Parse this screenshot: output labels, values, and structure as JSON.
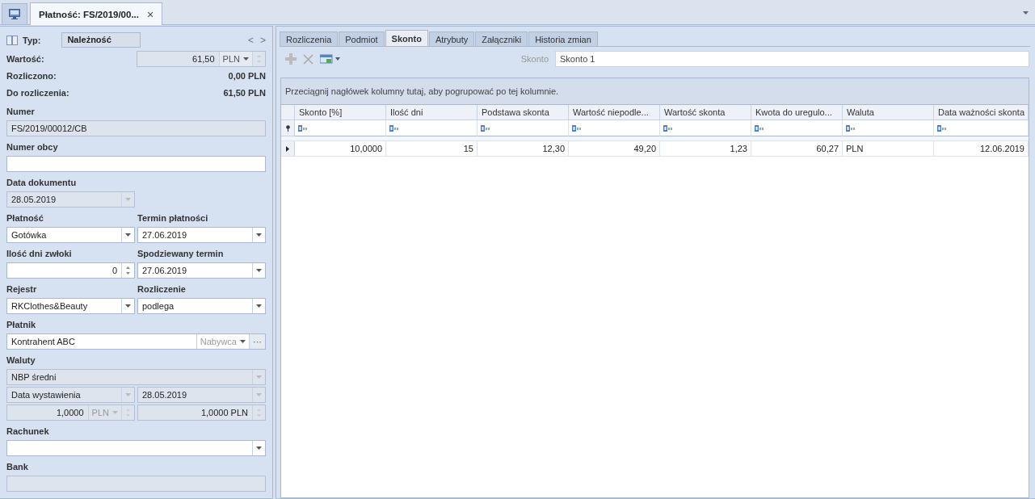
{
  "doc_tabs": [
    {
      "label": "Płatność: FS/2019/00...",
      "close": "×",
      "selected": true
    }
  ],
  "header": {
    "type_label": "Typ:",
    "type_value": "Należność",
    "prev": "<",
    "next": ">",
    "value_label": "Wartość:",
    "value_amount": "61,50",
    "value_currency": "PLN",
    "summary": [
      {
        "label": "Rozliczono:",
        "value": "0,00 PLN"
      },
      {
        "label": "Do rozliczenia:",
        "value": "61,50 PLN"
      }
    ]
  },
  "form": [
    {
      "kind": "full",
      "columns": [
        {
          "label": "Numer",
          "field": {
            "kind": "text",
            "value": "FS/2019/00012/CB",
            "disabled": true
          }
        }
      ]
    },
    {
      "kind": "full",
      "columns": [
        {
          "label": "Numer obcy",
          "field": {
            "kind": "text",
            "disabled": false
          }
        }
      ]
    },
    {
      "kind": "half",
      "columns": [
        {
          "label": "Data dokumentu",
          "field": {
            "kind": "dropdown",
            "value": "28.05.2019",
            "disabled": true
          }
        }
      ]
    },
    {
      "kind": "pair",
      "columns": [
        {
          "label": "Płatność",
          "field": {
            "kind": "dropdown",
            "value": "Gotówka",
            "disabled": false
          }
        },
        {
          "label": "Termin płatności",
          "field": {
            "kind": "dropdown",
            "value": "27.06.2019",
            "disabled": false
          }
        }
      ]
    },
    {
      "kind": "pair",
      "columns": [
        {
          "label": "Ilość dni zwłoki",
          "field": {
            "kind": "spin",
            "value": "0",
            "disabled": false
          }
        },
        {
          "label": "Spodziewany termin",
          "field": {
            "kind": "dropdown",
            "value": "27.06.2019",
            "disabled": false
          }
        }
      ]
    },
    {
      "kind": "pair",
      "columns": [
        {
          "label": "Rejestr",
          "field": {
            "kind": "dropdown",
            "value": "RKClothes&Beauty",
            "disabled": false
          }
        },
        {
          "label": "Rozliczenie",
          "field": {
            "kind": "dropdown",
            "value": "podlega",
            "disabled": false
          }
        }
      ]
    },
    {
      "kind": "full",
      "columns": [
        {
          "label": "Płatnik",
          "field": {
            "kind": "lookup",
            "value": "Kontrahent ABC",
            "role": "Nabywca",
            "more": "···",
            "disabled": false
          }
        }
      ]
    },
    {
      "kind": "full",
      "columns": [
        {
          "label": "Waluty",
          "field": {
            "kind": "dropdown",
            "value": "NBP średni",
            "disabled": true
          }
        }
      ]
    },
    {
      "kind": "pair",
      "columns": [
        {
          "field": {
            "kind": "dropdown",
            "value": "Data wystawienia",
            "disabled": true
          }
        },
        {
          "field": {
            "kind": "dropdown",
            "value": "28.05.2019",
            "disabled": true
          }
        }
      ]
    },
    {
      "kind": "pair",
      "columns": [
        {
          "field": {
            "kind": "currency-spin",
            "value": "1,0000",
            "currency": "PLN",
            "disabled": true
          }
        },
        {
          "field": {
            "kind": "spin",
            "value": "1,0000 PLN",
            "disabled": true
          }
        }
      ]
    },
    {
      "kind": "full",
      "columns": [
        {
          "label": "Rachunek",
          "field": {
            "kind": "dropdown",
            "disabled": false
          }
        }
      ]
    },
    {
      "kind": "full",
      "columns": [
        {
          "label": "Bank",
          "field": {
            "kind": "text",
            "disabled": true
          }
        }
      ]
    }
  ],
  "tabs": [
    {
      "label": "Rozliczenia",
      "selected": false
    },
    {
      "label": "Podmiot",
      "selected": false
    },
    {
      "label": "Skonto",
      "selected": true
    },
    {
      "label": "Atrybuty",
      "selected": false
    },
    {
      "label": "Załączniki",
      "selected": false
    },
    {
      "label": "Historia zmian",
      "selected": false
    }
  ],
  "toolbar": {
    "skonto_label": "Skonto",
    "skonto_value": "Skonto 1"
  },
  "grid": {
    "group_hint": "Przeciągnij nagłówek kolumny tutaj, aby pogrupować po tej kolumnie.",
    "columns": [
      {
        "label": "Skonto [%]",
        "kind": "number"
      },
      {
        "label": "Ilość dni",
        "kind": "number"
      },
      {
        "label": "Podstawa skonta",
        "kind": "number"
      },
      {
        "label": "Wartość niepodle...",
        "kind": "number"
      },
      {
        "label": "Wartość skonta",
        "kind": "number"
      },
      {
        "label": "Kwota do uregulo...",
        "kind": "number"
      },
      {
        "label": "Waluta",
        "kind": "text"
      },
      {
        "label": "Data ważności skonta",
        "kind": "number"
      }
    ],
    "rows": [
      {
        "selected": true,
        "cells": [
          "10,0000",
          "15",
          "12,30",
          "49,20",
          "1,23",
          "60,27",
          "PLN",
          "12.06.2019"
        ]
      }
    ]
  }
}
